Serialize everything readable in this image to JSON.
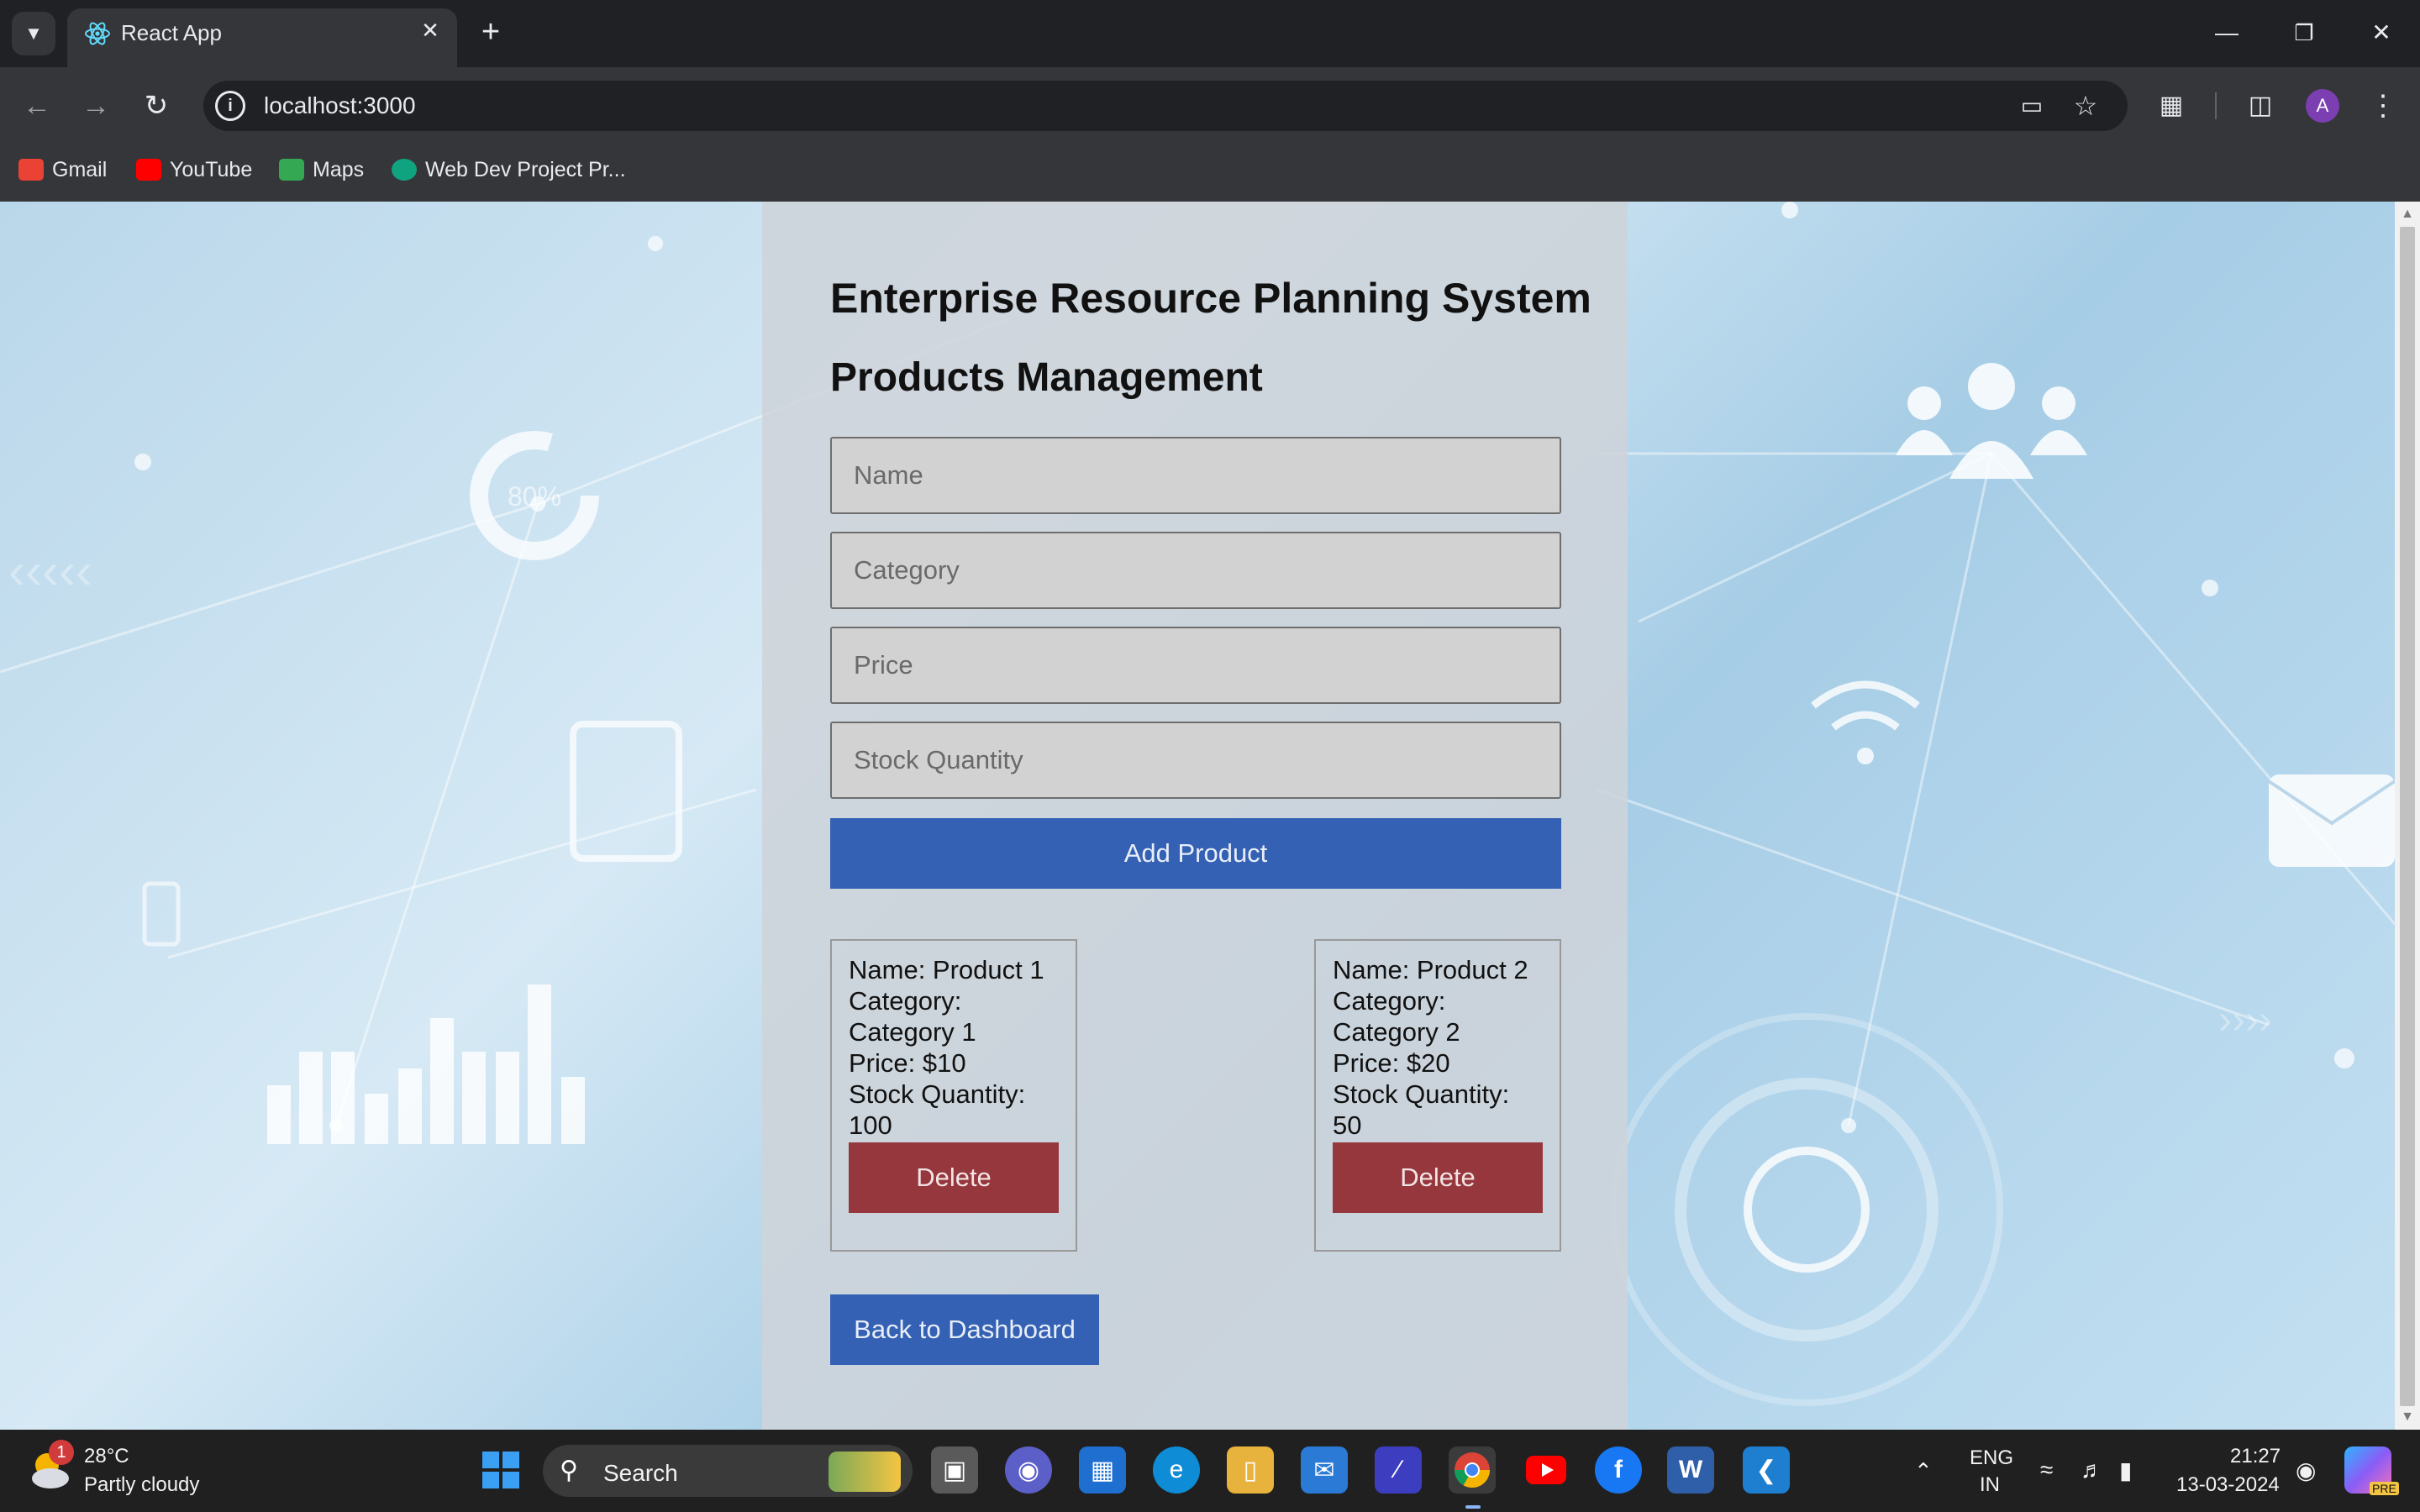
{
  "browser": {
    "tab_title": "React App",
    "url": "localhost:3000",
    "profile_initial": "A",
    "bookmarks": [
      {
        "label": "Gmail",
        "color": "#ea4335"
      },
      {
        "label": "YouTube",
        "color": "#ff0000"
      },
      {
        "label": "Maps",
        "color": "#34a853"
      },
      {
        "label": "Web Dev Project Pr...",
        "color": "#10a37f"
      }
    ]
  },
  "app": {
    "title": "Enterprise Resource Planning System",
    "subtitle": "Products Management",
    "form": {
      "name_placeholder": "Name",
      "category_placeholder": "Category",
      "price_placeholder": "Price",
      "stock_placeholder": "Stock Quantity",
      "add_button": "Add Product"
    },
    "products": [
      {
        "name": "Name: Product 1",
        "category_label": "Category:",
        "category": "Category 1",
        "price": "Price: $10",
        "stock_label": "Stock Quantity:",
        "stock": "100",
        "delete": "Delete"
      },
      {
        "name": "Name: Product 2",
        "category_label": "Category:",
        "category": "Category 2",
        "price": "Price: $20",
        "stock_label": "Stock Quantity:",
        "stock": "50",
        "delete": "Delete"
      }
    ],
    "back_button": "Back to Dashboard",
    "decor": {
      "gauge_label": "80%"
    }
  },
  "taskbar": {
    "weather_temp": "28°C",
    "weather_desc": "Partly cloudy",
    "weather_badge": "1",
    "search_placeholder": "Search",
    "lang_top": "ENG",
    "lang_bottom": "IN",
    "time": "21:27",
    "date": "13-03-2024",
    "copilot_badge": "PRE"
  },
  "colors": {
    "primary_button": "#3461b4",
    "delete_button": "#96363d"
  }
}
